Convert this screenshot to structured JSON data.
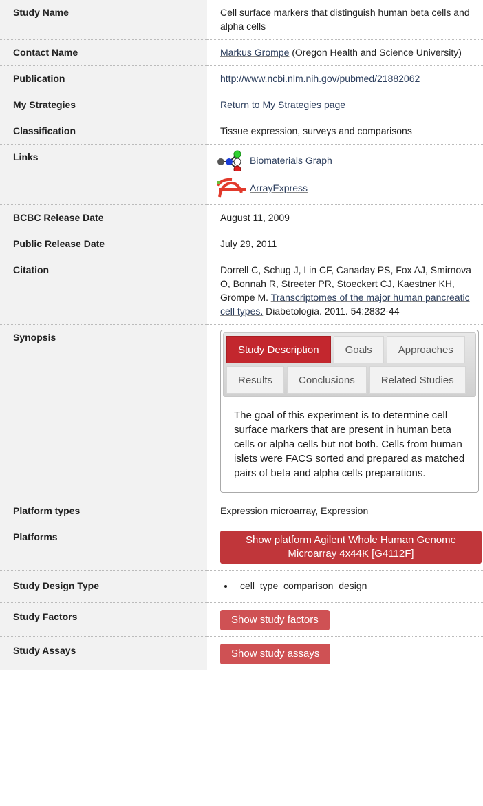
{
  "rows": {
    "study_name": {
      "label": "Study Name",
      "value": "Cell surface markers that distinguish human beta cells and alpha cells"
    },
    "contact": {
      "label": "Contact Name",
      "name": "Markus Grompe",
      "affiliation": " (Oregon Health and Science University)"
    },
    "publication": {
      "label": "Publication",
      "url": "http://www.ncbi.nlm.nih.gov/pubmed/21882062"
    },
    "strategies": {
      "label": "My Strategies",
      "link": "Return to My Strategies page"
    },
    "classification": {
      "label": "Classification",
      "value": "Tissue expression, surveys and comparisons"
    },
    "links": {
      "label": "Links",
      "items": [
        {
          "text": "Biomaterials Graph",
          "icon": "graph-icon"
        },
        {
          "text": "ArrayExpress",
          "icon": "arrayexpress-icon"
        }
      ]
    },
    "bcbc_release": {
      "label": "BCBC Release Date",
      "value": "August 11, 2009"
    },
    "public_release": {
      "label": "Public Release Date",
      "value": "July 29, 2011"
    },
    "citation": {
      "label": "Citation",
      "authors": "Dorrell C, Schug J, Lin CF, Canaday PS, Fox AJ, Smirnova O, Bonnah R, Streeter PR, Stoeckert CJ, Kaestner KH, Grompe M.",
      "title": "Transcriptomes of the major human pancreatic cell types.",
      "journal": " Diabetologia. 2011. 54:2832-44"
    },
    "synopsis": {
      "label": "Synopsis",
      "tabs": [
        "Study Description",
        "Goals",
        "Approaches",
        "Results",
        "Conclusions",
        "Related Studies"
      ],
      "active_tab": "Study Description",
      "content": "The goal of this experiment is to determine cell surface markers that are present in human beta cells or alpha cells but not both. Cells from human islets were FACS sorted and prepared as matched pairs of beta and alpha cells preparations."
    },
    "platform_types": {
      "label": "Platform types",
      "value": "Expression microarray, Expression"
    },
    "platforms": {
      "label": "Platforms",
      "button": "Show platform Agilent Whole Human Genome Microarray 4x44K [G4112F]"
    },
    "design_type": {
      "label": "Study Design Type",
      "items": [
        "cell_type_comparison_design"
      ]
    },
    "factors": {
      "label": "Study Factors",
      "button": "Show study factors"
    },
    "assays": {
      "label": "Study Assays",
      "button": "Show study assays"
    }
  },
  "colors": {
    "label_bg": "#f2f2f2",
    "accent_red": "#c3272e",
    "button_red": "#cf5154",
    "link": "#2b3d5c"
  }
}
